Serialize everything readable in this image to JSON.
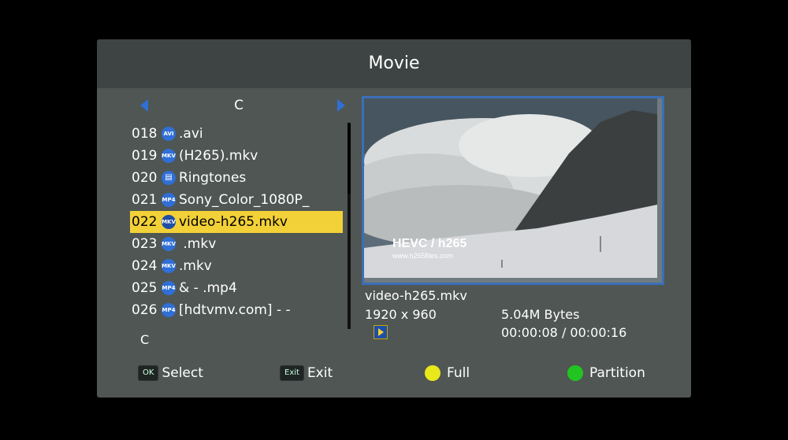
{
  "header": {
    "title": "Movie"
  },
  "nav": {
    "drive": "C"
  },
  "files": [
    {
      "num": "018",
      "icon": "AVI",
      "name": ".avi",
      "selected": false
    },
    {
      "num": "019",
      "icon": "MKV",
      "name": "(H265).mkv",
      "selected": false
    },
    {
      "num": "020",
      "icon": "DIR",
      "name": "Ringtones",
      "selected": false
    },
    {
      "num": "021",
      "icon": "MP4",
      "name": "Sony_Color_1080P_",
      "selected": false
    },
    {
      "num": "022",
      "icon": "MKV",
      "name": "video-h265.mkv",
      "selected": true
    },
    {
      "num": "023",
      "icon": "MKV",
      "name": " .mkv",
      "selected": false
    },
    {
      "num": "024",
      "icon": "MKV",
      "name": ".mkv",
      "selected": false
    },
    {
      "num": "025",
      "icon": "MP4",
      "name": "& -  .mp4",
      "selected": false
    },
    {
      "num": "026",
      "icon": "MP4",
      "name": "[hdtvmv.com] -  -",
      "selected": false
    }
  ],
  "path": {
    "drive": "C"
  },
  "preview": {
    "overlay_title": "HEVC / h265",
    "overlay_url": "www.h265files.com"
  },
  "info": {
    "filename": "video-h265.mkv",
    "resolution": "1920 x 960",
    "size": "5.04M Bytes",
    "time": "00:00:08 / 00:00:16"
  },
  "footer": {
    "ok_key": "OK",
    "select_label": "Select",
    "exit_key": "Exit",
    "exit_label": "Exit",
    "full_label": "Full",
    "partition_label": "Partition"
  },
  "colors": {
    "yellow": "#e8e81a",
    "green": "#22c422",
    "highlight": "#f2d037",
    "accent": "#2f6fd6"
  }
}
